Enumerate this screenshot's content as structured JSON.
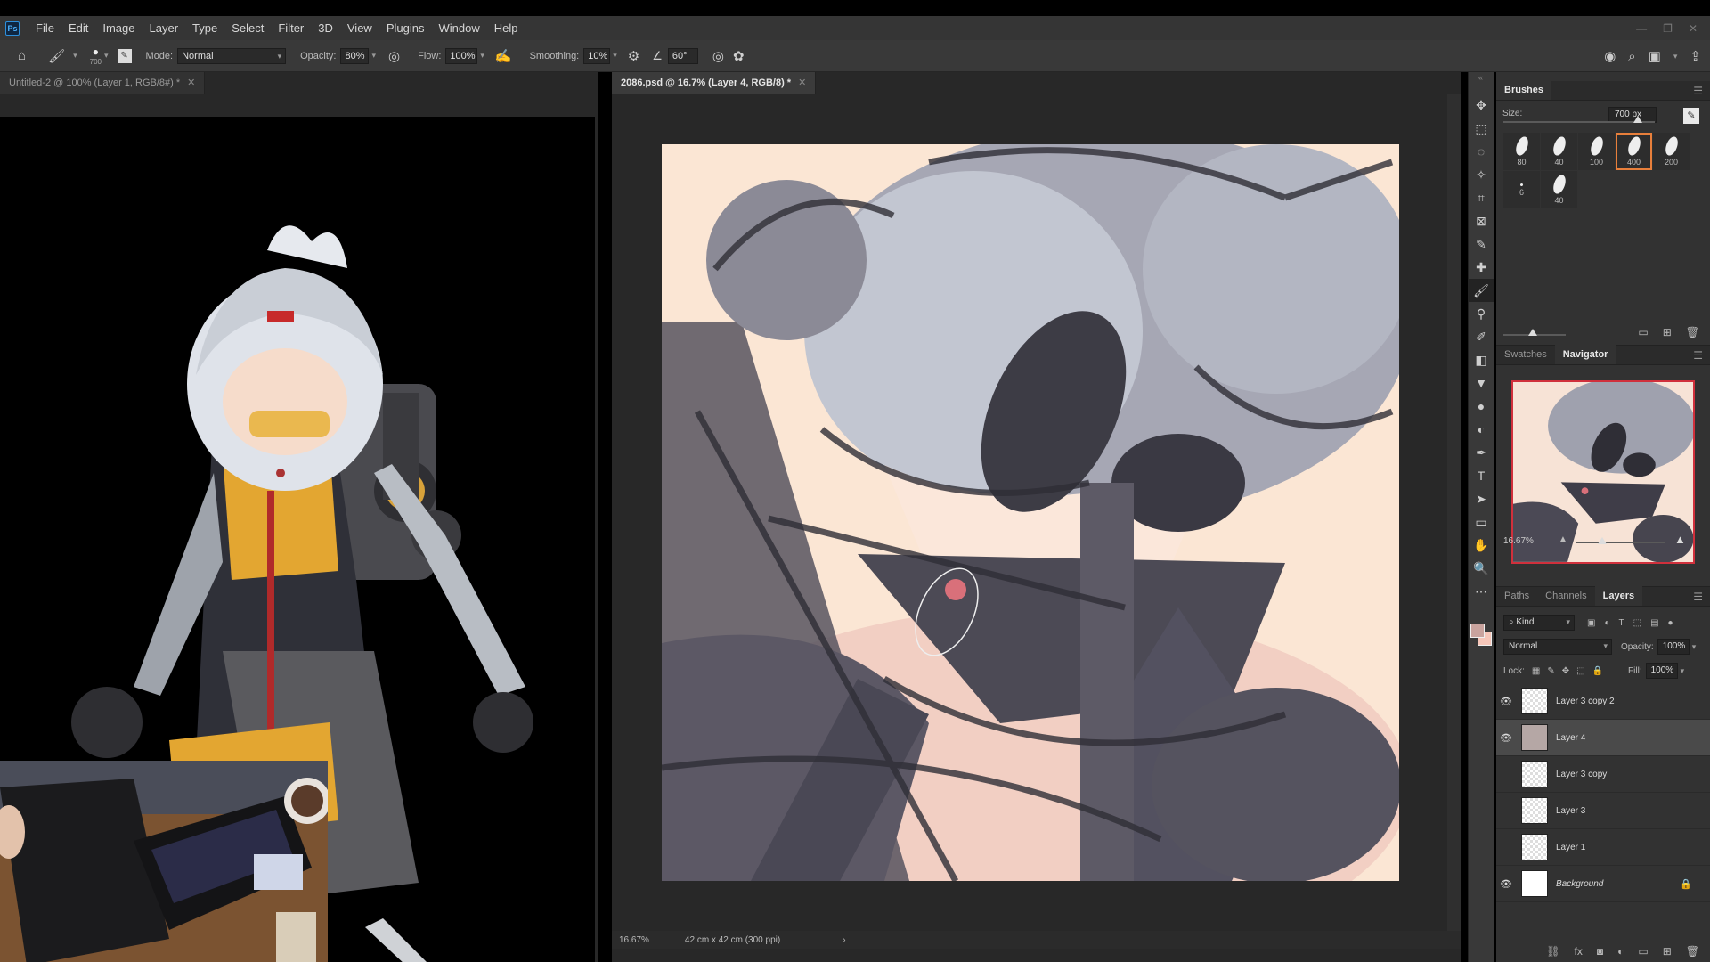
{
  "menubar": {
    "logo": "Ps",
    "items": [
      "File",
      "Edit",
      "Image",
      "Layer",
      "Type",
      "Select",
      "Filter",
      "3D",
      "View",
      "Plugins",
      "Window",
      "Help"
    ],
    "window_controls": [
      "minimize-icon",
      "restore-icon",
      "close-icon"
    ]
  },
  "options": {
    "brush_size": "700",
    "mode_label": "Mode:",
    "mode_value": "Normal",
    "opacity_label": "Opacity:",
    "opacity_value": "80%",
    "flow_label": "Flow:",
    "flow_value": "100%",
    "smoothing_label": "Smoothing:",
    "smoothing_value": "10%",
    "angle_value": "60°"
  },
  "documents": [
    {
      "title": "Untitled-2 @ 100% (Layer 1, RGB/8#) *",
      "active": false
    },
    {
      "title": "2086.psd @ 16.7% (Layer 4, RGB/8) *",
      "active": true
    }
  ],
  "status": {
    "zoom": "16.67%",
    "doc_info": "42 cm x 42 cm (300 ppi)",
    "arrow": "›"
  },
  "tools": [
    "move-icon",
    "marquee-icon",
    "lasso-icon",
    "magic-wand-icon",
    "crop-icon",
    "frame-icon",
    "eyedropper-icon",
    "healing-icon",
    "brush-icon",
    "stamp-icon",
    "history-brush-icon",
    "eraser-icon",
    "bucket-icon",
    "blur-icon",
    "dodge-icon",
    "pen-icon",
    "type-icon",
    "path-select-icon",
    "rectangle-icon",
    "hand-icon",
    "zoom-icon",
    "more-icon"
  ],
  "tool_glyphs": [
    "✥",
    "⬚",
    "◌",
    "✧",
    "⌗",
    "⊠",
    "✎",
    "✚",
    "🖌",
    "⚲",
    "✐",
    "◧",
    "▼",
    "●",
    "◐",
    "✒",
    "T",
    "➤",
    "▭",
    "✋",
    "🔍",
    "⋯"
  ],
  "brushes": {
    "title": "Brushes",
    "size_label": "Size:",
    "size_value": "700 px",
    "tips": [
      {
        "num": "80",
        "selected": false
      },
      {
        "num": "40",
        "selected": false
      },
      {
        "num": "100",
        "selected": false
      },
      {
        "num": "400",
        "selected": true
      },
      {
        "num": "200",
        "selected": false
      },
      {
        "num": "6",
        "selected": false
      },
      {
        "num": "40",
        "selected": false
      }
    ]
  },
  "navigator": {
    "tabs": [
      "Swatches",
      "Navigator"
    ],
    "zoom": "16.67%"
  },
  "layers_panel": {
    "tabs": [
      "Paths",
      "Channels",
      "Layers"
    ],
    "filter_label": "Kind",
    "blend_mode": "Normal",
    "opacity_label": "Opacity:",
    "opacity_value": "100%",
    "lock_label": "Lock:",
    "fill_label": "Fill:",
    "fill_value": "100%",
    "layers": [
      {
        "name": "Layer 3 copy 2",
        "visible": true,
        "selected": false,
        "thumb": "transparent"
      },
      {
        "name": "Layer 4",
        "visible": true,
        "selected": true,
        "thumb": "sketch"
      },
      {
        "name": "Layer 3 copy",
        "visible": false,
        "selected": false,
        "thumb": "transparent"
      },
      {
        "name": "Layer 3",
        "visible": false,
        "selected": false,
        "thumb": "transparent"
      },
      {
        "name": "Layer 1",
        "visible": false,
        "selected": false,
        "thumb": "transparent"
      },
      {
        "name": "Background",
        "visible": true,
        "selected": false,
        "thumb": "white",
        "locked": true
      }
    ]
  },
  "colors": {
    "foreground": "#c9a39e",
    "background": "#f6c6b9",
    "accent": "#e87f3b"
  }
}
